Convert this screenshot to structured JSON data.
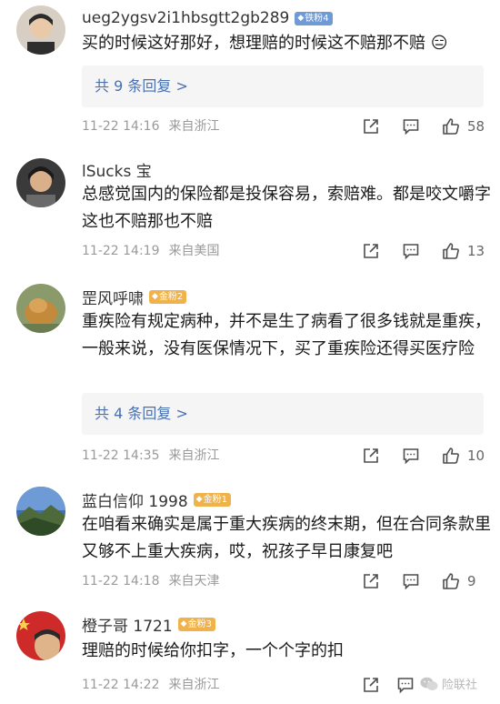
{
  "comments": [
    {
      "username": "ueg2ygsv2i1hbsgtt2gb289",
      "badge": "铁粉4",
      "text": "买的时候这好那好，想理赔的时候这不赔那不赔 😑",
      "replies": "共 9 条回复 >",
      "time": "11-22 14:16",
      "location": "来自浙江",
      "likes": "58"
    },
    {
      "username": "lSucks 宝",
      "badge": "",
      "text": "总感觉国内的保险都是投保容易，索赔难。都是咬文嚼字这也不赔那也不赔",
      "replies": "",
      "time": "11-22 14:19",
      "location": "来自美国",
      "likes": "13"
    },
    {
      "username": "罡风呼啸",
      "badge": "金粉2",
      "text": "重疾险有规定病种，并不是生了病看了很多钱就是重疾，一般来说，没有医保情况下，买了重疾险还得买医疗险",
      "replies": "共 4 条回复 >",
      "time": "11-22 14:35",
      "location": "来自浙江",
      "likes": "10"
    },
    {
      "username": "蓝白信仰 1998",
      "badge": "金粉1",
      "text": "在咱看来确实是属于重大疾病的终末期，但在合同条款里又够不上重大疾病，哎，祝孩子早日康复吧",
      "replies": "",
      "time": "11-22 14:18",
      "location": "来自天津",
      "likes": "9"
    },
    {
      "username": "橙子哥 1721",
      "badge": "金粉3",
      "text": "理赔的时候给你扣字，一个个字的扣",
      "replies": "",
      "time": "11-22 14:22",
      "location": "来自浙江",
      "likes": ""
    }
  ],
  "watermark": "险联社",
  "icons": {
    "share": "share-icon",
    "comment": "comment-icon",
    "like": "thumbs-up-icon",
    "badge": "diamond-icon"
  },
  "colors": {
    "link": "#4a70b0",
    "meta": "#9a9a9a",
    "iron_badge": "#6f9ad6",
    "gold_badge": "#f0b24a"
  }
}
